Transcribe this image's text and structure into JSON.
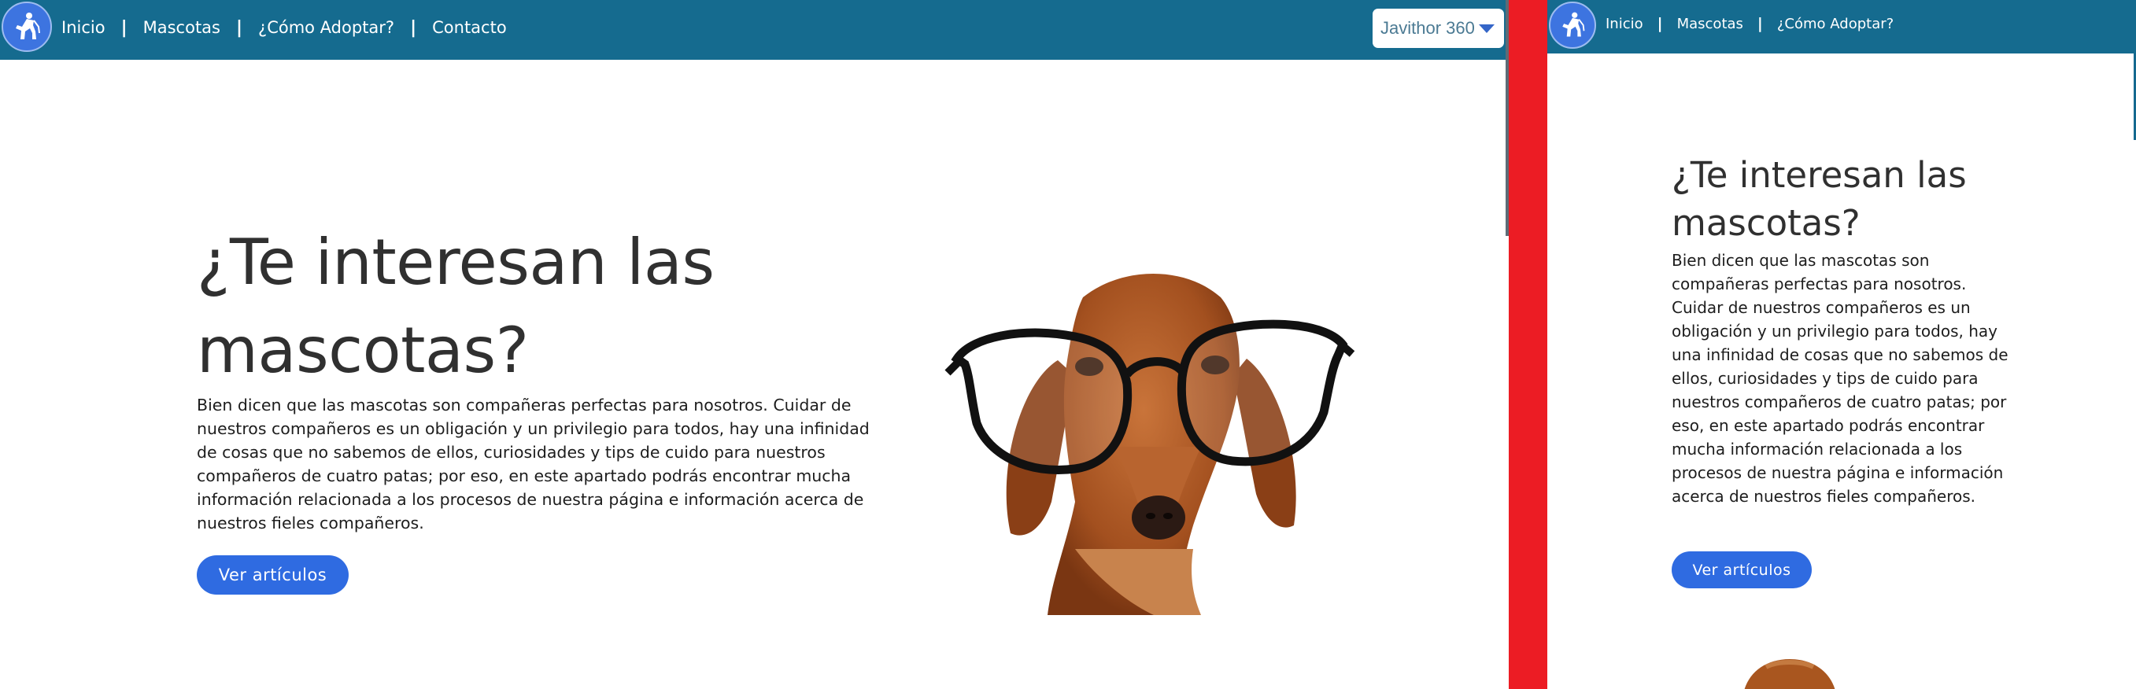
{
  "brand": {
    "logo_icon": "dog-walker-logo-icon"
  },
  "nav": {
    "items": [
      {
        "label": "Inicio"
      },
      {
        "label": "Mascotas"
      },
      {
        "label": "¿Cómo Adoptar?"
      },
      {
        "label": "Contacto"
      }
    ],
    "separator": "|"
  },
  "user": {
    "name": "Javithor 360",
    "dropdown_icon": "caret-down-icon"
  },
  "hero": {
    "title": "¿Te interesan las mascotas?",
    "text": "Bien dicen que las mascotas son compañeras perfectas para nosotros. Cuidar de nuestros compañeros es un obligación y un privilegio para todos, hay una infinidad de cosas que no sabemos de ellos, curiosidades y tips de cuido para nuestros compañeros de cuatro patas; por eso, en este apartado podrás encontrar mucha información relacionada a los procesos de nuestra página e información acerca de nuestros fieles compañeros.",
    "cta": "Ver artículos",
    "image": "dachshund-with-glasses"
  },
  "colors": {
    "navbar": "#156b8f",
    "button": "#2f6be1",
    "divider": "#ec1c24",
    "text": "#2f2f2f"
  }
}
